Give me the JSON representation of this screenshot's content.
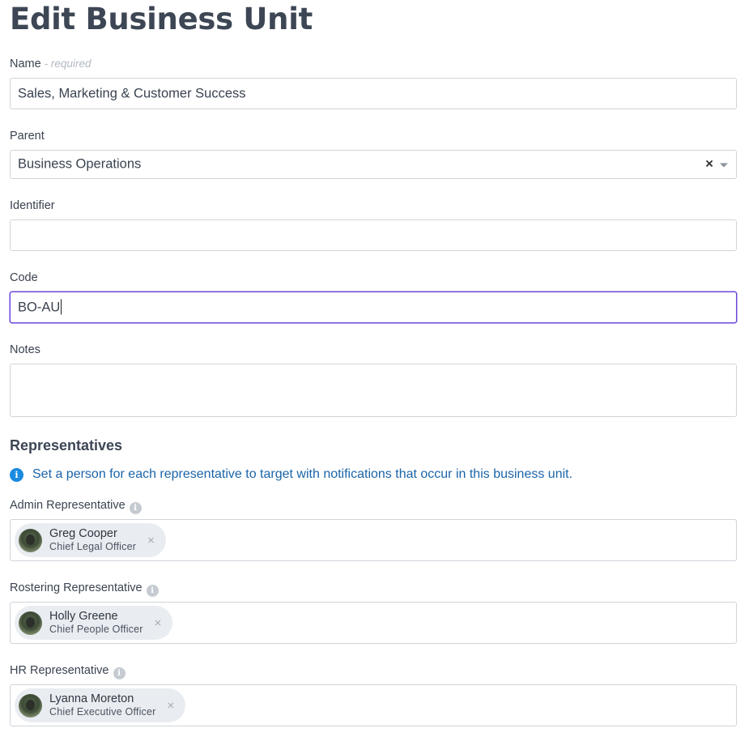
{
  "page": {
    "title": "Edit Business Unit"
  },
  "form": {
    "name": {
      "label": "Name",
      "required_hint": "- required",
      "value": "Sales, Marketing & Customer Success"
    },
    "parent": {
      "label": "Parent",
      "value": "Business Operations",
      "clear_symbol": "×"
    },
    "identifier": {
      "label": "Identifier",
      "value": ""
    },
    "code": {
      "label": "Code",
      "value": "BO-AU"
    },
    "notes": {
      "label": "Notes",
      "value": ""
    }
  },
  "representatives": {
    "title": "Representatives",
    "info": "Set a person for each representative to target with notifications that occur in this business unit.",
    "info_icon": "i",
    "help_icon": "i",
    "remove_symbol": "×",
    "admin": {
      "label": "Admin Representative",
      "person": {
        "name": "Greg Cooper",
        "role": "Chief Legal Officer"
      }
    },
    "rostering": {
      "label": "Rostering Representative",
      "person": {
        "name": "Holly Greene",
        "role": "Chief People Officer"
      }
    },
    "hr": {
      "label": "HR Representative",
      "person": {
        "name": "Lyanna Moreton",
        "role": "Chief Executive Officer"
      }
    }
  },
  "colors": {
    "focus": "#6c47d9",
    "info": "#1a8be0",
    "info_text": "#1a64a8"
  }
}
